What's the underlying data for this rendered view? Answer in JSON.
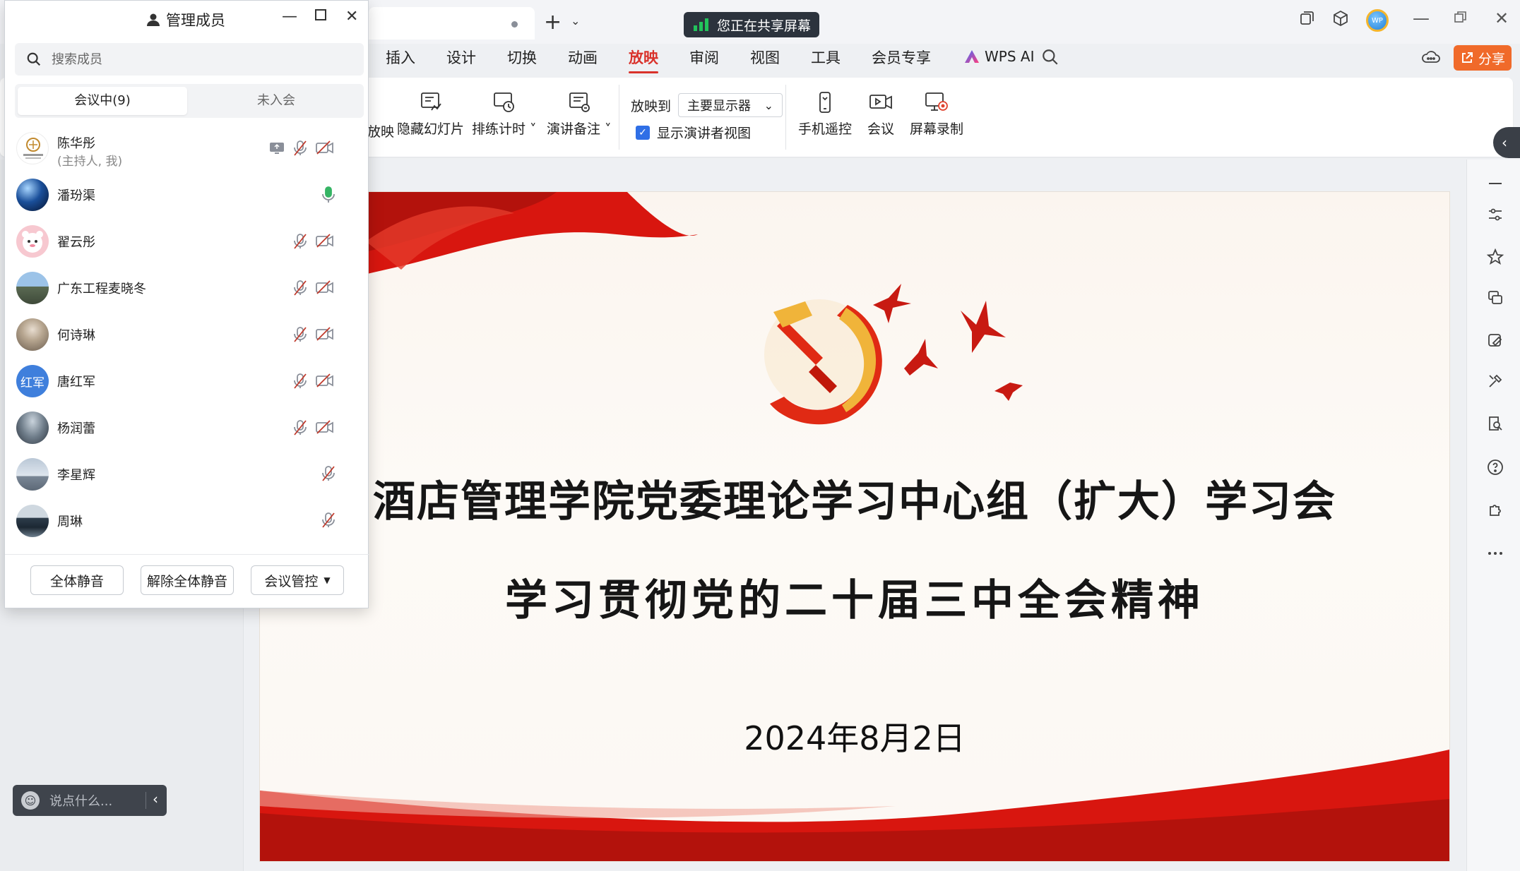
{
  "wps": {
    "share_status": "您正在共享屏幕",
    "ribbon_tabs": [
      {
        "label": "插入",
        "active": false
      },
      {
        "label": "设计",
        "active": false
      },
      {
        "label": "切换",
        "active": false
      },
      {
        "label": "动画",
        "active": false
      },
      {
        "label": "放映",
        "active": true
      },
      {
        "label": "审阅",
        "active": false
      },
      {
        "label": "视图",
        "active": false
      },
      {
        "label": "工具",
        "active": false
      },
      {
        "label": "会员专享",
        "active": false
      }
    ],
    "wps_ai_label": "WPS AI",
    "share_button_label": "分享",
    "avatar_text": "WP",
    "toolbar": {
      "partial_label": "放映",
      "hide_slide": "隐藏幻灯片",
      "rehearse": "排练计时",
      "notes": "演讲备注",
      "play_to_label": "放映到",
      "play_to_value": "主要显示器",
      "presenter_view": "显示演讲者视图",
      "phone_remote": "手机遥控",
      "meeting": "会议",
      "screen_record": "屏幕录制"
    }
  },
  "slide": {
    "title1": "酒店管理学院党委理论学习中心组（扩大）学习会",
    "title2": "学习贯彻党的二十届三中全会精神",
    "date": "2024年8月2日"
  },
  "chat": {
    "placeholder": "说点什么..."
  },
  "members": {
    "title": "管理成员",
    "search_placeholder": "搜索成员",
    "tabs": {
      "in_meeting": "会议中(9)",
      "not_joined": "未入会"
    },
    "people": [
      {
        "name": "陈华彤",
        "sub": "(主持人, 我)",
        "avatar": "logo"
      },
      {
        "name": "潘玢渠",
        "avatar": "planet"
      },
      {
        "name": "翟云彤",
        "avatar": "cartoon"
      },
      {
        "name": "广东工程麦晓冬",
        "avatar": "scenery"
      },
      {
        "name": "何诗琳",
        "avatar": "photo"
      },
      {
        "name": "唐红军",
        "avatar": "initials",
        "initials": "红军"
      },
      {
        "name": "杨润蕾",
        "avatar": "portrait"
      },
      {
        "name": "李星辉",
        "avatar": "lake"
      },
      {
        "name": "周琳",
        "avatar": "landscape"
      }
    ],
    "buttons": {
      "mute_all": "全体静音",
      "unmute_all": "解除全体静音",
      "control": "会议管控"
    }
  }
}
